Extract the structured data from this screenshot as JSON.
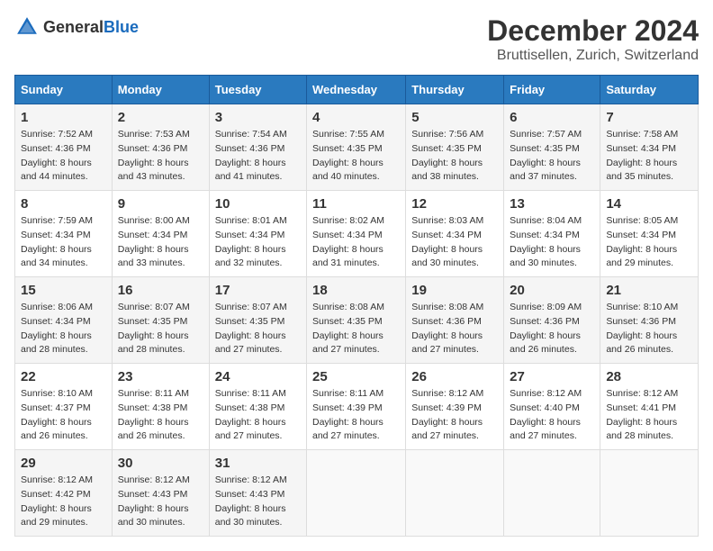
{
  "header": {
    "logo_general": "General",
    "logo_blue": "Blue",
    "title": "December 2024",
    "subtitle": "Bruttisellen, Zurich, Switzerland"
  },
  "calendar": {
    "days_of_week": [
      "Sunday",
      "Monday",
      "Tuesday",
      "Wednesday",
      "Thursday",
      "Friday",
      "Saturday"
    ],
    "weeks": [
      [
        {
          "day": "1",
          "sunrise": "7:52 AM",
          "sunset": "4:36 PM",
          "daylight": "8 hours and 44 minutes."
        },
        {
          "day": "2",
          "sunrise": "7:53 AM",
          "sunset": "4:36 PM",
          "daylight": "8 hours and 43 minutes."
        },
        {
          "day": "3",
          "sunrise": "7:54 AM",
          "sunset": "4:36 PM",
          "daylight": "8 hours and 41 minutes."
        },
        {
          "day": "4",
          "sunrise": "7:55 AM",
          "sunset": "4:35 PM",
          "daylight": "8 hours and 40 minutes."
        },
        {
          "day": "5",
          "sunrise": "7:56 AM",
          "sunset": "4:35 PM",
          "daylight": "8 hours and 38 minutes."
        },
        {
          "day": "6",
          "sunrise": "7:57 AM",
          "sunset": "4:35 PM",
          "daylight": "8 hours and 37 minutes."
        },
        {
          "day": "7",
          "sunrise": "7:58 AM",
          "sunset": "4:34 PM",
          "daylight": "8 hours and 35 minutes."
        }
      ],
      [
        {
          "day": "8",
          "sunrise": "7:59 AM",
          "sunset": "4:34 PM",
          "daylight": "8 hours and 34 minutes."
        },
        {
          "day": "9",
          "sunrise": "8:00 AM",
          "sunset": "4:34 PM",
          "daylight": "8 hours and 33 minutes."
        },
        {
          "day": "10",
          "sunrise": "8:01 AM",
          "sunset": "4:34 PM",
          "daylight": "8 hours and 32 minutes."
        },
        {
          "day": "11",
          "sunrise": "8:02 AM",
          "sunset": "4:34 PM",
          "daylight": "8 hours and 31 minutes."
        },
        {
          "day": "12",
          "sunrise": "8:03 AM",
          "sunset": "4:34 PM",
          "daylight": "8 hours and 30 minutes."
        },
        {
          "day": "13",
          "sunrise": "8:04 AM",
          "sunset": "4:34 PM",
          "daylight": "8 hours and 30 minutes."
        },
        {
          "day": "14",
          "sunrise": "8:05 AM",
          "sunset": "4:34 PM",
          "daylight": "8 hours and 29 minutes."
        }
      ],
      [
        {
          "day": "15",
          "sunrise": "8:06 AM",
          "sunset": "4:34 PM",
          "daylight": "8 hours and 28 minutes."
        },
        {
          "day": "16",
          "sunrise": "8:07 AM",
          "sunset": "4:35 PM",
          "daylight": "8 hours and 28 minutes."
        },
        {
          "day": "17",
          "sunrise": "8:07 AM",
          "sunset": "4:35 PM",
          "daylight": "8 hours and 27 minutes."
        },
        {
          "day": "18",
          "sunrise": "8:08 AM",
          "sunset": "4:35 PM",
          "daylight": "8 hours and 27 minutes."
        },
        {
          "day": "19",
          "sunrise": "8:08 AM",
          "sunset": "4:36 PM",
          "daylight": "8 hours and 27 minutes."
        },
        {
          "day": "20",
          "sunrise": "8:09 AM",
          "sunset": "4:36 PM",
          "daylight": "8 hours and 26 minutes."
        },
        {
          "day": "21",
          "sunrise": "8:10 AM",
          "sunset": "4:36 PM",
          "daylight": "8 hours and 26 minutes."
        }
      ],
      [
        {
          "day": "22",
          "sunrise": "8:10 AM",
          "sunset": "4:37 PM",
          "daylight": "8 hours and 26 minutes."
        },
        {
          "day": "23",
          "sunrise": "8:11 AM",
          "sunset": "4:38 PM",
          "daylight": "8 hours and 26 minutes."
        },
        {
          "day": "24",
          "sunrise": "8:11 AM",
          "sunset": "4:38 PM",
          "daylight": "8 hours and 27 minutes."
        },
        {
          "day": "25",
          "sunrise": "8:11 AM",
          "sunset": "4:39 PM",
          "daylight": "8 hours and 27 minutes."
        },
        {
          "day": "26",
          "sunrise": "8:12 AM",
          "sunset": "4:39 PM",
          "daylight": "8 hours and 27 minutes."
        },
        {
          "day": "27",
          "sunrise": "8:12 AM",
          "sunset": "4:40 PM",
          "daylight": "8 hours and 27 minutes."
        },
        {
          "day": "28",
          "sunrise": "8:12 AM",
          "sunset": "4:41 PM",
          "daylight": "8 hours and 28 minutes."
        }
      ],
      [
        {
          "day": "29",
          "sunrise": "8:12 AM",
          "sunset": "4:42 PM",
          "daylight": "8 hours and 29 minutes."
        },
        {
          "day": "30",
          "sunrise": "8:12 AM",
          "sunset": "4:43 PM",
          "daylight": "8 hours and 30 minutes."
        },
        {
          "day": "31",
          "sunrise": "8:12 AM",
          "sunset": "4:43 PM",
          "daylight": "8 hours and 30 minutes."
        },
        null,
        null,
        null,
        null
      ]
    ],
    "labels": {
      "sunrise": "Sunrise:",
      "sunset": "Sunset:",
      "daylight": "Daylight:"
    }
  }
}
